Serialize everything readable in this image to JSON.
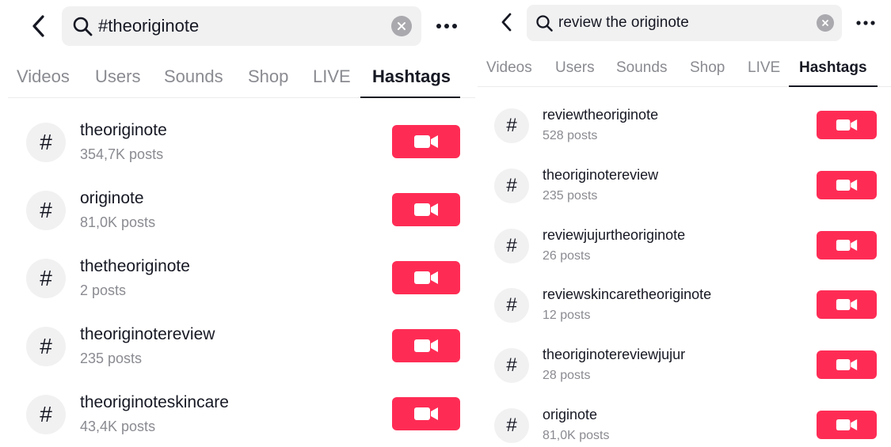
{
  "colors": {
    "accent": "#fe2c55",
    "text": "#161823",
    "muted": "#8a8b91",
    "bg_gray": "#f1f1f2"
  },
  "left": {
    "search": {
      "query": "#theoriginote"
    },
    "tabs": [
      "Videos",
      "Users",
      "Sounds",
      "Shop",
      "LIVE",
      "Hashtags"
    ],
    "active_tab": "Hashtags",
    "icons": {
      "back": "chevron-left-icon",
      "search": "search-icon",
      "clear": "clear-icon",
      "more": "more-icon",
      "hashtag": "hashtag-icon",
      "record": "video-camera-icon"
    },
    "hashtags": [
      {
        "name": "theoriginote",
        "posts": "354,7K posts"
      },
      {
        "name": "originote",
        "posts": "81,0K posts"
      },
      {
        "name": "thetheoriginote",
        "posts": "2 posts"
      },
      {
        "name": "theoriginotereview",
        "posts": "235 posts"
      },
      {
        "name": "theoriginoteskincare",
        "posts": "43,4K posts"
      }
    ]
  },
  "right": {
    "search": {
      "query": "review the originote"
    },
    "tabs": [
      "Videos",
      "Users",
      "Sounds",
      "Shop",
      "LIVE",
      "Hashtags"
    ],
    "active_tab": "Hashtags",
    "icons": {
      "back": "chevron-left-icon",
      "search": "search-icon",
      "clear": "clear-icon",
      "more": "more-icon",
      "hashtag": "hashtag-icon",
      "record": "video-camera-icon"
    },
    "hashtags": [
      {
        "name": "reviewtheoriginote",
        "posts": "528 posts"
      },
      {
        "name": "theoriginotereview",
        "posts": "235 posts"
      },
      {
        "name": "reviewjujurtheoriginote",
        "posts": "26 posts"
      },
      {
        "name": "reviewskincaretheoriginote",
        "posts": "12 posts"
      },
      {
        "name": "theoriginotereviewjujur",
        "posts": "28 posts"
      },
      {
        "name": "originote",
        "posts": "81,0K posts"
      }
    ]
  }
}
